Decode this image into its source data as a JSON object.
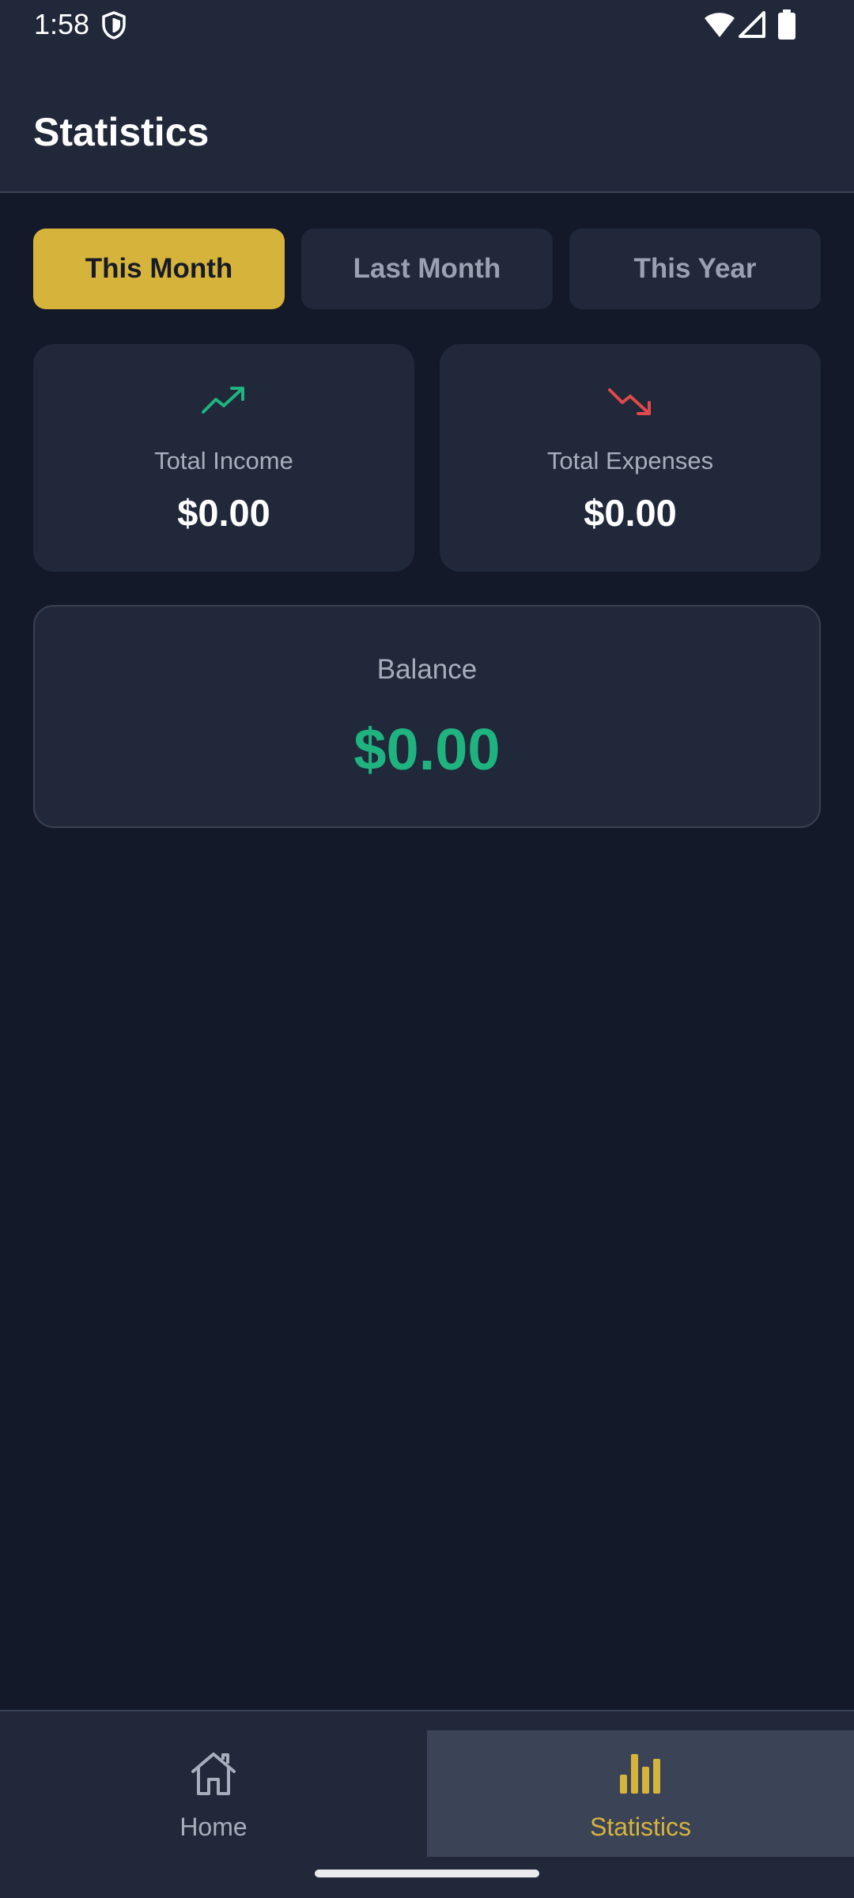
{
  "status_bar": {
    "time": "1:58",
    "icons": [
      "shield-icon",
      "wifi-icon",
      "signal-icon",
      "battery-icon"
    ]
  },
  "header": {
    "title": "Statistics"
  },
  "filter": {
    "options": [
      "This Month",
      "Last Month",
      "This Year"
    ],
    "selected": "This Month"
  },
  "summary": {
    "income": {
      "label": "Total Income",
      "amount": "$0.00",
      "icon": "trending-up-icon",
      "color": "#1fb37f"
    },
    "expenses": {
      "label": "Total Expenses",
      "amount": "$0.00",
      "icon": "trending-down-icon",
      "color": "#e04a4a"
    }
  },
  "balance": {
    "label": "Balance",
    "amount": "$0.00",
    "color": "#1fb37f"
  },
  "nav": {
    "items": [
      {
        "label": "Home",
        "icon": "home-icon"
      },
      {
        "label": "Statistics",
        "icon": "bar-chart-icon"
      }
    ],
    "active": "Statistics"
  },
  "colors": {
    "accent": "#d6b33b",
    "background": "#131929",
    "surface": "#20283a"
  }
}
